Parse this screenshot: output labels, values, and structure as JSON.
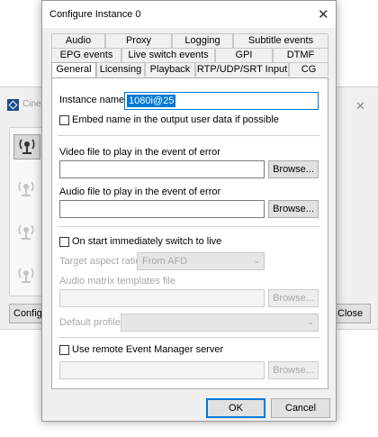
{
  "background_window": {
    "title": "Cine",
    "close_glyph": "✕",
    "left_button": "Configure",
    "right_button": "Close"
  },
  "dialog": {
    "title": "Configure Instance 0",
    "close_glyph": "✕",
    "tab_rows": [
      [
        "Audio",
        "Proxy",
        "Logging",
        "Subtitle events"
      ],
      [
        "EPG events",
        "Live switch events",
        "GPI",
        "DTMF"
      ],
      [
        "General",
        "Licensing",
        "Playback",
        "RTP/UDP/SRT Input",
        "CG"
      ]
    ],
    "active_tab": "General"
  },
  "general": {
    "instance_name_label": "Instance name",
    "instance_name_value": "1080i@25",
    "embed_name_label": "Embed name in the output user data if possible",
    "video_error_label": "Video file to play in the event of error",
    "video_error_value": "",
    "audio_error_label": "Audio file to play in the event of error",
    "audio_error_value": "",
    "browse_label": "Browse...",
    "switch_live_label": "On start immediately switch to live",
    "aspect_ratio_label": "Target aspect ratio",
    "aspect_ratio_value": "From AFD",
    "audio_matrix_label": "Audio matrix templates file",
    "default_profile_label": "Default profile",
    "default_profile_value": "",
    "remote_em_label": "Use remote Event Manager server",
    "remote_em_value": ""
  },
  "footer": {
    "ok_label": "OK",
    "cancel_label": "Cancel"
  },
  "icons": {
    "combo_arrow": "⌄"
  }
}
